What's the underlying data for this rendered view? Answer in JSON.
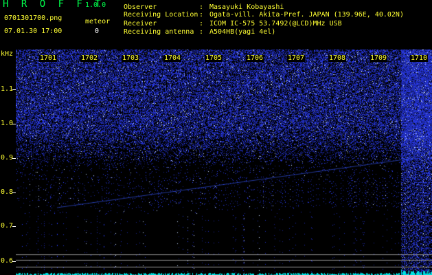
{
  "app": {
    "title": "H R O F F T",
    "version": "1.0.0",
    "filename": "0701301700.png",
    "datetime": "07.01.30 17:00",
    "meteor_label": "meteor",
    "meteor_count": "0"
  },
  "info": [
    {
      "label": "Observer",
      "value": "Masayuki Kobayashi"
    },
    {
      "label": "Receiving Location",
      "value": "Ogata-vill. Akita-Pref. JAPAN (139.96E, 40.02N)"
    },
    {
      "label": "Receiver",
      "value": "ICOM IC-575 53.7492(@LCD)MHz USB"
    },
    {
      "label": "Receiving antenna",
      "value": "A504HB(yagi 4el)"
    }
  ],
  "spectrogram": {
    "y_unit": "kHz",
    "y_ticks": [
      "1.1",
      "1.0",
      "0.9",
      "0.8",
      "0.7",
      "0.6"
    ],
    "x_ticks": [
      "1701",
      "1702",
      "1703",
      "1704",
      "1705",
      "1706",
      "1707",
      "1708",
      "1709",
      "1710"
    ],
    "noise_color": "#2a3cff",
    "highlight_color": "#ffffff",
    "trace_color": "#3a5cff",
    "baseline_color": "#00e0e0"
  }
}
